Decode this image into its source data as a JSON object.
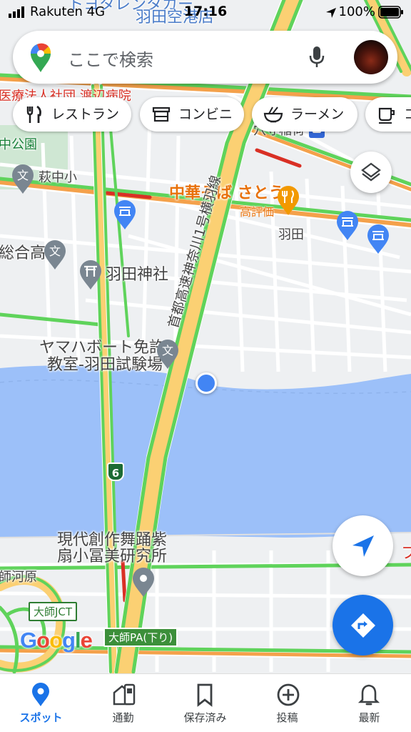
{
  "status_bar": {
    "carrier": "Rakuten 4G",
    "time": "17:16",
    "battery": "100%"
  },
  "search": {
    "placeholder": "ここで検索"
  },
  "chips": [
    {
      "label": "レストラン",
      "icon": "fork-knife-icon"
    },
    {
      "label": "コンビニ",
      "icon": "store-icon"
    },
    {
      "label": "ラーメン",
      "icon": "ramen-icon"
    },
    {
      "label": "コ",
      "icon": "coffee-icon"
    }
  ],
  "map_labels": {
    "top_partial_1": "トヨタレンタカー",
    "top_partial_2": "羽田空港店",
    "hospital_partial": "医療法人社団 渡辺病院",
    "park_partial": "中公園",
    "anamori": "穴守稲荷",
    "school_haginaka": "萩中小",
    "restaurant_name": "中華そば さとう",
    "restaurant_rating": "高評価",
    "haneda": "羽田",
    "school_sogo": "総合高",
    "shrine": "羽田神社",
    "expressway": "首都高速神奈川1号横羽線",
    "driving_school_1": "ヤマハボート免許",
    "driving_school_2": "教室-羽田試験場",
    "route_6": "6",
    "dance_1": "現代創作舞踊紫",
    "dance_2": "扇小冨美研究所",
    "daishi_kawara": "師河原",
    "daishi_jct": "大師JCT",
    "daishi_pa": "大師PA(下り)",
    "right_edge": "フ"
  },
  "google_logo": "Google",
  "nav": [
    {
      "label": "スポット",
      "icon": "explore-pin-icon",
      "active": true
    },
    {
      "label": "通勤",
      "icon": "commute-icon",
      "active": false
    },
    {
      "label": "保存済み",
      "icon": "bookmark-icon",
      "active": false
    },
    {
      "label": "投稿",
      "icon": "add-circle-icon",
      "active": false
    },
    {
      "label": "最新",
      "icon": "bell-icon",
      "active": false
    }
  ],
  "colors": {
    "accent": "#1a73e8",
    "water": "#9cc0f9",
    "traffic_green": "#5fd35b",
    "highway": "#fbd073",
    "traffic_red": "#d93025"
  }
}
